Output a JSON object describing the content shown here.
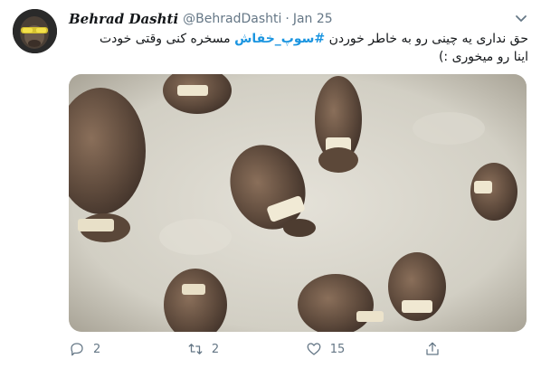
{
  "tweet": {
    "display_name": "Behrad Dashti",
    "handle": "@BehradDashti",
    "separator": "·",
    "date": "Jan 25",
    "text_line1_prefix": "حق نداری یه چینی رو به خاطر خوردن ",
    "hashtag": "#سوپ_خفاش",
    "text_line1_suffix": " مسخره کنی وقتی خودت",
    "text_line2": "اینا رو میخوری :)",
    "media_icon": "photo-of-boiled-sheep-heads-in-broth",
    "replies": "2",
    "retweets": "2",
    "likes": "15"
  },
  "icons": {
    "caret": "chevron-down-icon",
    "reply": "reply-icon",
    "retweet": "retweet-icon",
    "like": "heart-icon",
    "share": "share-icon"
  },
  "colors": {
    "accent": "#1b95e0",
    "muted": "#657786",
    "text": "#14171a"
  }
}
